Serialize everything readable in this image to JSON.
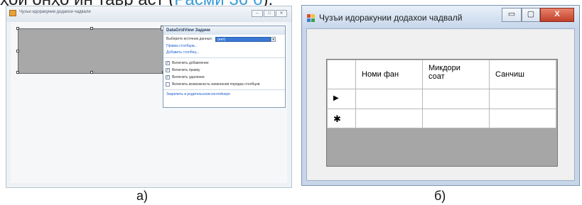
{
  "top_text": {
    "prefix": "ҳои онҳо ин тавр аст (",
    "link": "Расми 36 б",
    "suffix": ")."
  },
  "window_a": {
    "title": "Чузъи идоракунии додахои чадвали",
    "buttons": [
      "–",
      "□",
      "✕"
    ],
    "tasks": {
      "header": "DataGridView Задачи",
      "source_label": "Выберите источник данных:",
      "source_value": "(нет)",
      "links": [
        "Правка столбцов...",
        "Добавить столбец..."
      ],
      "options": [
        {
          "label": "Включить добавление",
          "checked": true
        },
        {
          "label": "Включить правку",
          "checked": true
        },
        {
          "label": "Включить удаление",
          "checked": true
        },
        {
          "label": "Включить возможность изменения порядка столбцов",
          "checked": false
        }
      ],
      "dock_link": "Закрепить в родительском контейнере"
    }
  },
  "window_b": {
    "title": "Чузъи идоракунии додахои чадвалй",
    "buttons": {
      "minimize": "▭",
      "maximize": "▢",
      "close": "X"
    },
    "columns": [
      "Номи фан",
      "Микдори соат",
      "Санчиш"
    ],
    "row_markers": [
      "▶",
      "✱"
    ]
  },
  "captions": {
    "a": "а)",
    "b": "б)"
  },
  "colors": {
    "link": "#3b9bd6",
    "grid_bg": "#a6a6a6",
    "selection": "#3a78d6"
  }
}
